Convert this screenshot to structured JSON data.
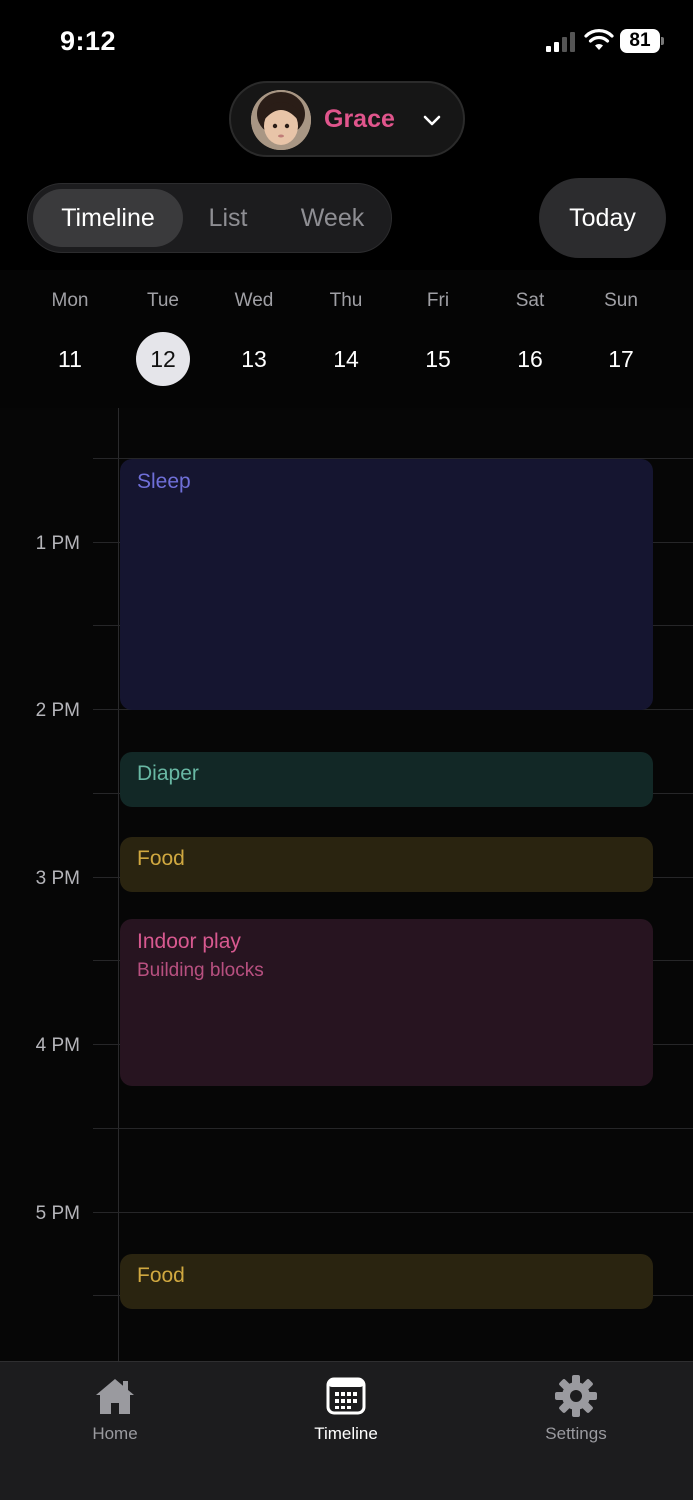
{
  "status_bar": {
    "time": "9:12",
    "battery": "81"
  },
  "profile": {
    "name": "Grace",
    "name_color": "#e0558c"
  },
  "view_modes": {
    "timeline": "Timeline",
    "list": "List",
    "week": "Week",
    "selected": "Timeline"
  },
  "today_button": "Today",
  "week": {
    "days": [
      {
        "name": "Mon",
        "num": "11"
      },
      {
        "name": "Tue",
        "num": "12"
      },
      {
        "name": "Wed",
        "num": "13"
      },
      {
        "name": "Thu",
        "num": "14"
      },
      {
        "name": "Fri",
        "num": "15"
      },
      {
        "name": "Sat",
        "num": "16"
      },
      {
        "name": "Sun",
        "num": "17"
      }
    ],
    "selected_day": "12"
  },
  "timeline": {
    "hours": [
      "1 PM",
      "2 PM",
      "3 PM",
      "4 PM",
      "5 PM"
    ],
    "events": [
      {
        "title": "Sleep",
        "subtitle": "",
        "color": "#6f6fd8"
      },
      {
        "title": "Diaper",
        "subtitle": "",
        "color": "#69b8a4"
      },
      {
        "title": "Food",
        "subtitle": "",
        "color": "#d0a840"
      },
      {
        "title": "Indoor play",
        "subtitle": "Building blocks",
        "color": "#d85990"
      },
      {
        "title": "Food",
        "subtitle": "",
        "color": "#d0a840"
      }
    ]
  },
  "tab_bar": {
    "items": [
      {
        "label": "Home",
        "icon": "home-icon"
      },
      {
        "label": "Timeline",
        "icon": "calendar-icon"
      },
      {
        "label": "Settings",
        "icon": "gear-icon"
      }
    ],
    "active": "Timeline"
  }
}
